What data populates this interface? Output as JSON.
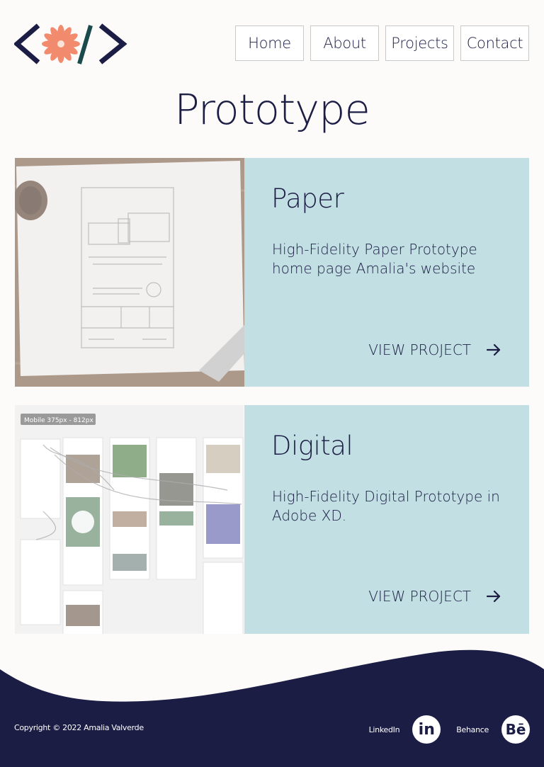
{
  "header": {
    "logo_icon": "code-flower-logo",
    "nav": [
      {
        "label": "Home"
      },
      {
        "label": "About"
      },
      {
        "label": "Projects"
      },
      {
        "label": "Contact"
      }
    ]
  },
  "page": {
    "title": "Prototype"
  },
  "cards": [
    {
      "title": "Paper",
      "description": "High-Fidelity Paper Prototype home page Amalia's website",
      "link_label": "VIEW PROJECT",
      "image": "paper-prototype-sketch"
    },
    {
      "title": "Digital",
      "description": "High-Fidelity Digital Prototype in Adobe XD.",
      "link_label": "VIEW PROJECT",
      "image": "adobe-xd-prototype-screens",
      "image_caption": "Mobile 375px - 812px"
    }
  ],
  "footer": {
    "copyright": "Copyright © 2022 Amalia Valverde",
    "linkedin_label": "LinkedIn",
    "linkedin_icon_text": "in",
    "behance_label": "Behance",
    "behance_icon_text": "Bē"
  },
  "colors": {
    "navy": "#1c1d45",
    "card_bg": "#c2dfe3",
    "accent_coral": "#f28b6e",
    "page_bg": "#fcfbfa"
  }
}
